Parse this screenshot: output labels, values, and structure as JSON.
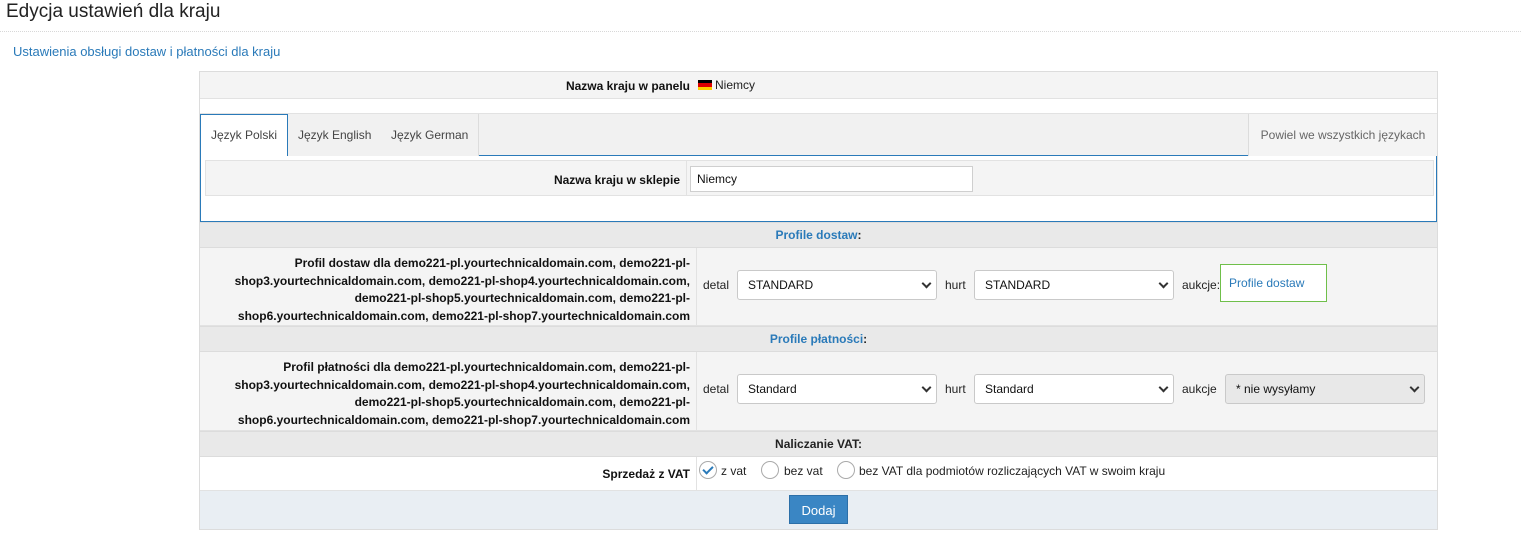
{
  "page": {
    "title": "Edycja ustawień dla kraju",
    "subtitle_link": "Ustawienia obsługi dostaw i płatności dla kraju"
  },
  "country_name": {
    "label": "Nazwa kraju w panelu",
    "value": "Niemcy",
    "flag_colors": [
      "#000000",
      "#dd0000",
      "#ffce00"
    ]
  },
  "tabs": {
    "items": [
      {
        "label": "Język Polski",
        "active": true
      },
      {
        "label": "Język English",
        "active": false
      },
      {
        "label": "Język German",
        "active": false
      }
    ],
    "repeat_label": "Powiel we wszystkich językach"
  },
  "shop_name": {
    "label": "Nazwa kraju w sklepie",
    "value": "Niemcy"
  },
  "delivery": {
    "section_title": "Profile dostaw",
    "section_colon": ":",
    "label": "Profil dostaw dla demo221-pl.yourtechnicaldomain.com, demo221-pl-shop3.yourtechnicaldomain.com, demo221-pl-shop4.yourtechnicaldomain.com, demo221-pl-shop5.yourtechnicaldomain.com, demo221-pl-shop6.yourtechnicaldomain.com, demo221-pl-shop7.yourtechnicaldomain.com",
    "label_lines": [
      "Profil dostaw dla demo221-pl.yourtechnicaldomain.com, demo221-pl-",
      "shop3.yourtechnicaldomain.com, demo221-pl-shop4.yourtechnicaldomain.com,",
      "demo221-pl-shop5.yourtechnicaldomain.com, demo221-pl-",
      "shop6.yourtechnicaldomain.com, demo221-pl-shop7.yourtechnicaldomain.com"
    ],
    "detal_label": "detal",
    "detal_value": "STANDARD",
    "hurt_label": "hurt",
    "hurt_value": "STANDARD",
    "aukcje_label": "aukcje:",
    "aukcje_link": "Profile dostaw"
  },
  "payment": {
    "section_title": "Profile płatności",
    "section_colon": ":",
    "label_lines": [
      "Profil płatności dla demo221-pl.yourtechnicaldomain.com, demo221-pl-",
      "shop3.yourtechnicaldomain.com, demo221-pl-shop4.yourtechnicaldomain.com,",
      "demo221-pl-shop5.yourtechnicaldomain.com, demo221-pl-",
      "shop6.yourtechnicaldomain.com, demo221-pl-shop7.yourtechnicaldomain.com"
    ],
    "detal_label": "detal",
    "detal_value": "Standard",
    "hurt_label": "hurt",
    "hurt_value": "Standard",
    "aukcje_label": "aukcje",
    "aukcje_value": "* nie wysyłamy"
  },
  "vat": {
    "section_title": "Naliczanie VAT:",
    "label": "Sprzedaż z VAT",
    "options": [
      {
        "label": "z vat",
        "checked": true
      },
      {
        "label": "bez vat",
        "checked": false
      },
      {
        "label": "bez VAT dla podmiotów rozliczających VAT w swoim kraju",
        "checked": false
      }
    ]
  },
  "actions": {
    "submit_label": "Dodaj"
  }
}
